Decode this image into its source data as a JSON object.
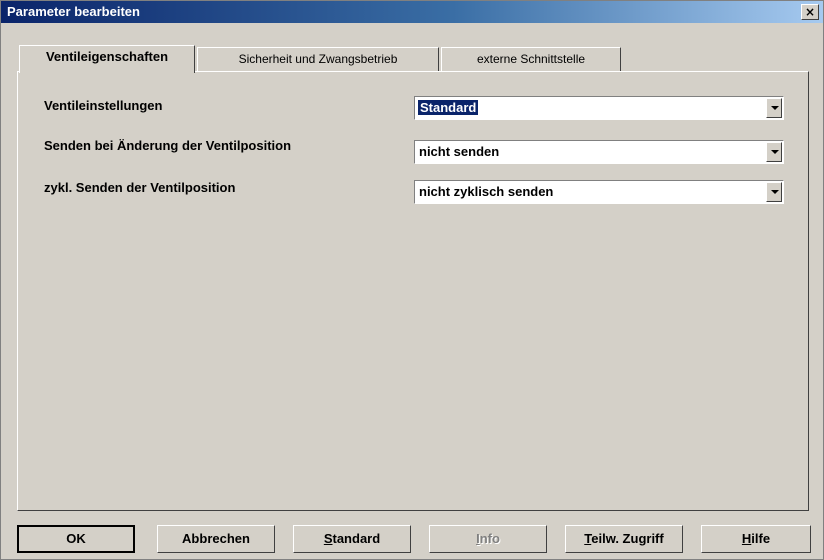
{
  "window": {
    "title": "Parameter bearbeiten",
    "close_label": "×"
  },
  "tabs": [
    {
      "label": "Ventileigenschaften",
      "active": true
    },
    {
      "label": "Sicherheit und Zwangsbetrieb",
      "active": false
    },
    {
      "label": "externe Schnittstelle",
      "active": false
    }
  ],
  "params": [
    {
      "label": "Ventileinstellungen",
      "value": "Standard"
    },
    {
      "label": "Senden bei Änderung der Ventilposition",
      "value": "nicht senden"
    },
    {
      "label": "zykl. Senden der Ventilposition",
      "value": "nicht zyklisch senden"
    }
  ],
  "buttons": {
    "ok": "OK",
    "cancel": "Abbrechen",
    "standard_first": "S",
    "standard_rest": "tandard",
    "info_first": "I",
    "info_rest": "nfo",
    "partial_first": "T",
    "partial_rest": "eilw. Zugriff",
    "help_first": "H",
    "help_rest": "ilfe"
  },
  "colors": {
    "face": "#d4d0c8",
    "title_start": "#0a246a",
    "title_end": "#a6caf0",
    "selection": "#0a246a"
  }
}
